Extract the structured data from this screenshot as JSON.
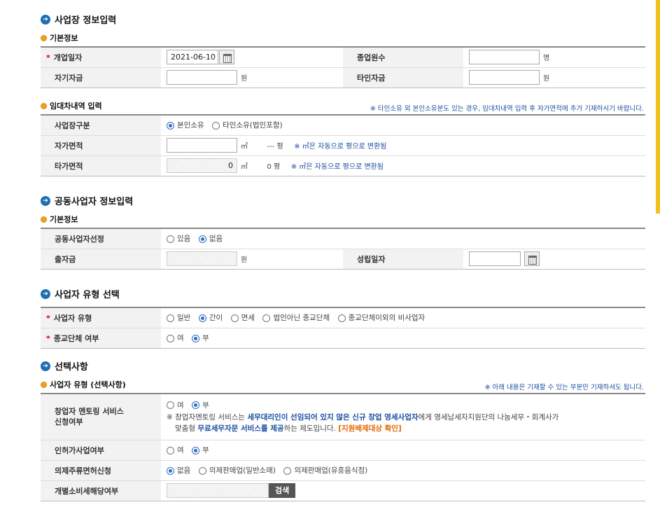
{
  "section1": {
    "title": "사업장 정보입력",
    "sub1": "기본정보",
    "open_date_label": "개업일자",
    "open_date_value": "2021-06-10",
    "employees_label": "종업원수",
    "employees_unit": "명",
    "own_capital_label": "자기자금",
    "own_capital_unit": "원",
    "other_capital_label": "타인자금",
    "other_capital_unit": "원",
    "sub2": "임대차내역 입력",
    "lease_note": "※ 타인소유 외 본인소유분도 있는 경우, 임대차내역 입력 후 자가면적에 추가 기재하시기 바랍니다.",
    "site_type_label": "사업장구분",
    "site_type_options": [
      "본인소유",
      "타인소유(법인포함)"
    ],
    "own_area_label": "자가면적",
    "own_area_unit": "㎡",
    "own_area_pyeong": "--- 평",
    "area_conv_note": "※ ㎡은 자동으로 평으로 변환됨",
    "other_area_label": "타가면적",
    "other_area_value": "0",
    "other_area_unit": "㎡",
    "other_area_pyeong": "0 평"
  },
  "section2": {
    "title": "공동사업자 정보입력",
    "sub1": "기본정보",
    "joint_select_label": "공동사업자선정",
    "joint_options": [
      "있음",
      "없음"
    ],
    "investment_label": "출자금",
    "investment_unit": "원",
    "establish_date_label": "성립일자"
  },
  "section3": {
    "title": "사업자 유형 선택",
    "biz_type_label": "사업자 유형",
    "biz_type_options": [
      "일반",
      "간이",
      "면세",
      "법인아닌 종교단체",
      "종교단체이외의 비사업자"
    ],
    "religious_label": "종교단체 여부",
    "yesno": [
      "여",
      "부"
    ]
  },
  "section4": {
    "title": "선택사항",
    "sub1": "사업자 유형 (선택사항)",
    "note": "※ 아래 내용은 기재할 수 있는 부분만 기재하셔도 됩니다.",
    "mentoring_label_1": "창업자 멘토링 서비스",
    "mentoring_label_2": "신청여부",
    "mentoring_desc_1": "※ 창업자멘토링 서비스는 ",
    "mentoring_desc_2": "세무대리인이 선임되어 있지 않은 신규 창업 영세사업자",
    "mentoring_desc_3": "에게 영세납세자지원단의 나눔세무・회계사가",
    "mentoring_desc_4": "맞춤형 ",
    "mentoring_desc_5": "무료세무자문 서비스를 제공",
    "mentoring_desc_6": "하는 제도입니다. ",
    "mentoring_desc_7": "[지원배제대상 확인]",
    "license_label": "인허가사업여부",
    "liquor_label": "의제주류면허신청",
    "liquor_options": [
      "없음",
      "의제판매업(일반소매)",
      "의제판매업(유흥음식점)"
    ],
    "excise_label": "개별소비세해당여부",
    "search_button": "검색"
  }
}
